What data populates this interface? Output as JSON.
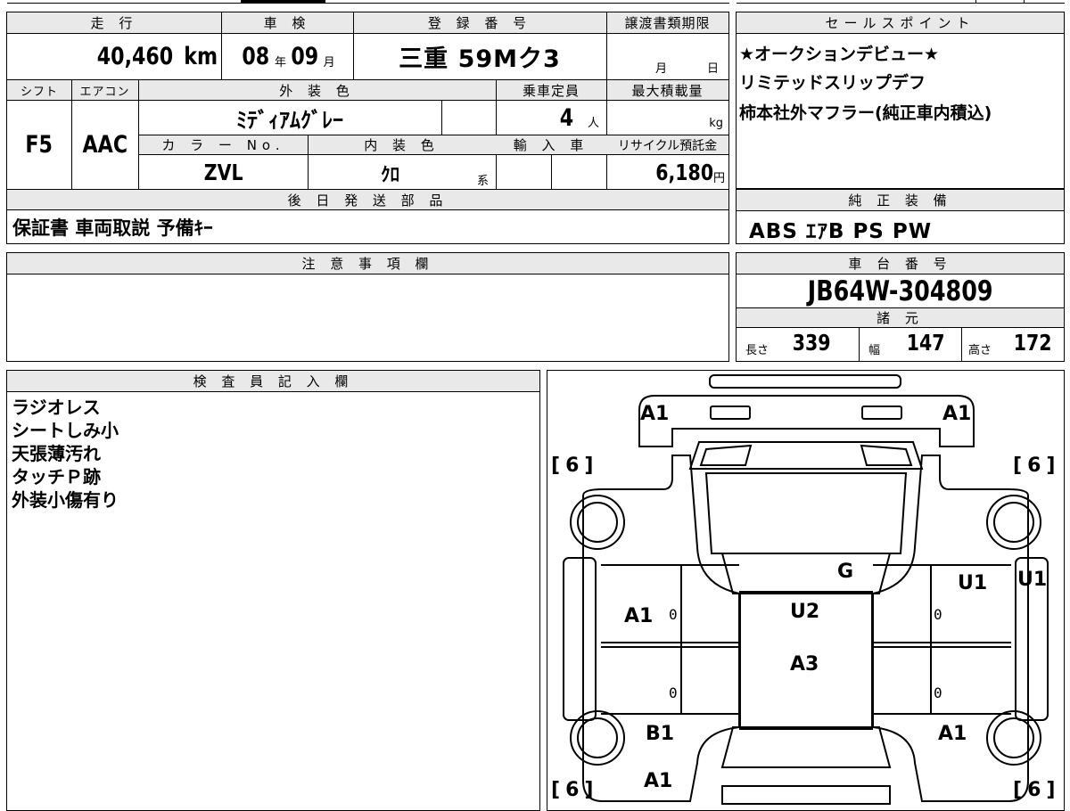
{
  "header": {
    "mileage_label": "走 行",
    "shaken_label": "車 検",
    "reg_label": "登 録 番 号",
    "transfer_label": "譲渡書類期限",
    "sales_label": "セールスポイント"
  },
  "vehicle": {
    "mileage_value": "40,460",
    "mileage_unit": "km",
    "shaken_year": "08",
    "shaken_year_unit": "年",
    "shaken_month": "09",
    "shaken_month_unit": "月",
    "registration": "三重 59Mク3",
    "transfer_month_unit": "月",
    "transfer_day_unit": "日"
  },
  "row2": {
    "shift_label": "シフト",
    "aircon_label": "エアコン",
    "exterior_label": "外 装 色",
    "capacity_label": "乗車定員",
    "load_label": "最大積載量",
    "shift_value": "F5",
    "aircon_value": "AAC",
    "exterior_value": "ﾐﾃﾞｨｱﾑｸﾞﾚｰ",
    "capacity_value": "4",
    "capacity_unit": "人",
    "load_unit": "kg",
    "color_no_label": "カ ラ ー No.",
    "interior_label": "内 装 色",
    "import_label": "輸 入 車",
    "recycle_label": "リサイクル預託金",
    "color_no_value": "ZVL",
    "interior_value": "ｸﾛ",
    "interior_unit": "系",
    "recycle_value": "6,180",
    "recycle_unit": "円"
  },
  "sales_points": [
    "★オークションデビュー★",
    "リミテッドスリップデフ",
    "柿本社外マフラー(純正車内積込)"
  ],
  "later_parts": {
    "label": "後 日 発 送 部 品",
    "value": "保証書 車両取説 予備ｷｰ"
  },
  "equipment": {
    "label": "純 正 装 備",
    "value": "ABS ｴｱB PS PW"
  },
  "notes": {
    "label": "注 意 事 項 欄"
  },
  "chassis": {
    "label": "車 台 番 号",
    "value": "JB64W-304809",
    "specs_label": "諸 元",
    "length_label": "長さ",
    "length_value": "339",
    "width_label": "幅",
    "width_value": "147",
    "height_label": "高さ",
    "height_value": "172"
  },
  "inspector": {
    "label": "検 査 員 記 入 欄",
    "lines": [
      "ラジオレス",
      "シートしみ小",
      "天張薄汚れ",
      "タッチＰ跡",
      "外装小傷有り"
    ]
  },
  "diagram": {
    "marks": {
      "front_left": "A1",
      "front_right": "A1",
      "tire_fl": "6",
      "tire_fr": "6",
      "tire_rl": "6",
      "tire_rr": "6",
      "glass": "G",
      "roof": "U2",
      "right_front_door": "U1",
      "right_side": "U1",
      "left_front_door": "A1",
      "roof_rear": "A3",
      "left_rear": "B1",
      "right_rear": "A1",
      "rear": "A1",
      "zero_lf": "0",
      "zero_lr": "0",
      "zero_rf": "0",
      "zero_rr": "0"
    }
  }
}
